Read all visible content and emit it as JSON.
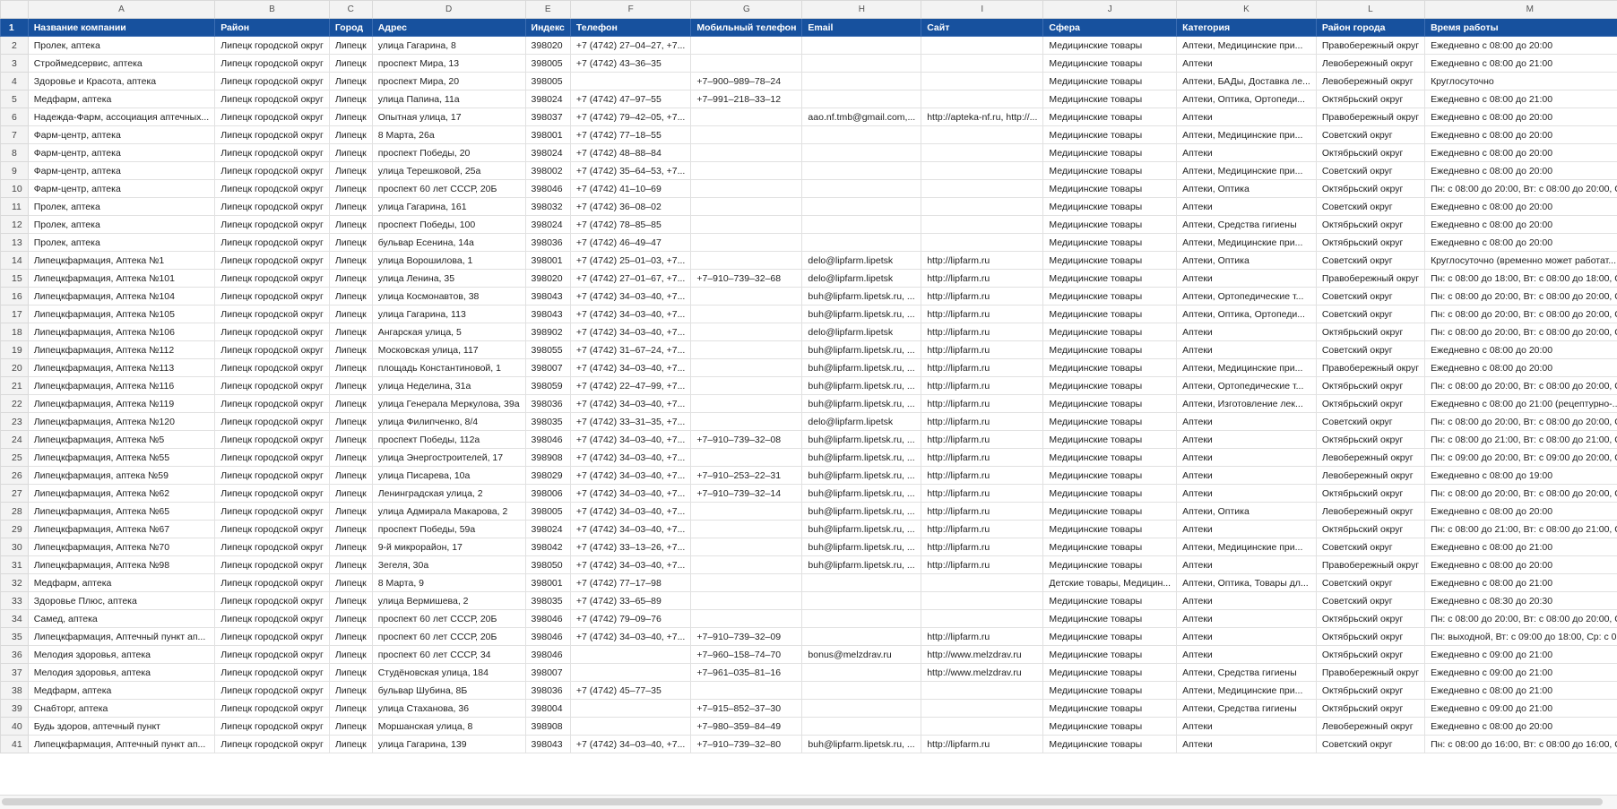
{
  "columns": [
    "A",
    "B",
    "C",
    "D",
    "E",
    "F",
    "G",
    "H",
    "I",
    "J",
    "K",
    "L",
    "M"
  ],
  "header": {
    "num": "1",
    "cells": [
      "Название компании",
      "Район",
      "Город",
      "Адрес",
      "Индекс",
      "Телефон",
      "Мобильный телефон",
      "Email",
      "Сайт",
      "Сфера",
      "Категория",
      "Район города",
      "Время работы"
    ]
  },
  "rows": [
    {
      "num": "2",
      "cells": [
        "Пролек, аптека",
        "Липецк городской округ",
        "Липецк",
        "улица Гагарина, 8",
        "398020",
        "+7 (4742) 27‒04‒27, +7...",
        "",
        "",
        "",
        "Медицинские товары",
        "Аптеки, Медицинские при...",
        "Правобережный округ",
        "Ежедневно с 08:00 до 20:00"
      ]
    },
    {
      "num": "3",
      "cells": [
        "Строймедсервис, аптека",
        "Липецк городской округ",
        "Липецк",
        "проспект Мира, 13",
        "398005",
        "+7 (4742) 43‒36‒35",
        "",
        "",
        "",
        "Медицинские товары",
        "Аптеки",
        "Левобережный округ",
        "Ежедневно с 08:00 до 21:00"
      ]
    },
    {
      "num": "4",
      "cells": [
        "Здоровье и Красота, аптека",
        "Липецк городской округ",
        "Липецк",
        "проспект Мира, 20",
        "398005",
        "",
        "+7‒900‒989‒78‒24",
        "",
        "",
        "Медицинские товары",
        "Аптеки, БАДы, Доставка ле...",
        "Левобережный округ",
        "Круглосуточно"
      ]
    },
    {
      "num": "5",
      "cells": [
        "Медфарм, аптека",
        "Липецк городской округ",
        "Липецк",
        "улица Папина, 11а",
        "398024",
        "+7 (4742) 47‒97‒55",
        "+7‒991‒218‒33‒12",
        "",
        "",
        "Медицинские товары",
        "Аптеки, Оптика, Ортопеди...",
        "Октябрьский округ",
        "Ежедневно с 08:00 до 21:00"
      ]
    },
    {
      "num": "6",
      "cells": [
        "Надежда-Фарм, ассоциация аптечных...",
        "Липецк городской округ",
        "Липецк",
        "Опытная улица, 17",
        "398037",
        "+7 (4742) 79‒42‒05, +7...",
        "",
        "aao.nf.tmb@gmail.com,...",
        "http://apteka-nf.ru, http://...",
        "Медицинские товары",
        "Аптеки",
        "Правобережный округ",
        "Ежедневно с 08:00 до 20:00"
      ]
    },
    {
      "num": "7",
      "cells": [
        "Фарм-центр, аптека",
        "Липецк городской округ",
        "Липецк",
        "8 Марта, 26а",
        "398001",
        "+7 (4742) 77‒18‒55",
        "",
        "",
        "",
        "Медицинские товары",
        "Аптеки, Медицинские при...",
        "Советский округ",
        "Ежедневно с 08:00 до 20:00"
      ]
    },
    {
      "num": "8",
      "cells": [
        "Фарм-центр, аптека",
        "Липецк городской округ",
        "Липецк",
        "проспект Победы, 20",
        "398024",
        "+7 (4742) 48‒88‒84",
        "",
        "",
        "",
        "Медицинские товары",
        "Аптеки",
        "Октябрьский округ",
        "Ежедневно с 08:00 до 20:00"
      ]
    },
    {
      "num": "9",
      "cells": [
        "Фарм-центр, аптека",
        "Липецк городской округ",
        "Липецк",
        "улица Терешковой, 25а",
        "398002",
        "+7 (4742) 35‒64‒53, +7...",
        "",
        "",
        "",
        "Медицинские товары",
        "Аптеки, Медицинские при...",
        "Советский округ",
        "Ежедневно с 08:00 до 20:00"
      ]
    },
    {
      "num": "10",
      "cells": [
        "Фарм-центр, аптека",
        "Липецк городской округ",
        "Липецк",
        "проспект 60 лет СССР, 20Б",
        "398046",
        "+7 (4742) 41‒10‒69",
        "",
        "",
        "",
        "Медицинские товары",
        "Аптеки, Оптика",
        "Октябрьский округ",
        "Пн: с 08:00 до 20:00, Вт: с 08:00 до 20:00, С..."
      ]
    },
    {
      "num": "11",
      "cells": [
        "Пролек, аптека",
        "Липецк городской округ",
        "Липецк",
        "улица Гагарина, 161",
        "398032",
        "+7 (4742) 36‒08‒02",
        "",
        "",
        "",
        "Медицинские товары",
        "Аптеки",
        "Советский округ",
        "Ежедневно с 08:00 до 20:00"
      ]
    },
    {
      "num": "12",
      "cells": [
        "Пролек, аптека",
        "Липецк городской округ",
        "Липецк",
        "проспект Победы, 100",
        "398024",
        "+7 (4742) 78‒85‒85",
        "",
        "",
        "",
        "Медицинские товары",
        "Аптеки, Средства гигиены",
        "Октябрьский округ",
        "Ежедневно с 08:00 до 20:00"
      ]
    },
    {
      "num": "13",
      "cells": [
        "Пролек, аптека",
        "Липецк городской округ",
        "Липецк",
        "бульвар Есенина, 14а",
        "398036",
        "+7 (4742) 46‒49‒47",
        "",
        "",
        "",
        "Медицинские товары",
        "Аптеки, Медицинские при...",
        "Октябрьский округ",
        "Ежедневно с 08:00 до 20:00"
      ]
    },
    {
      "num": "14",
      "cells": [
        "Липецкфармация, Аптека №1",
        "Липецк городской округ",
        "Липецк",
        "улица Ворошилова, 1",
        "398001",
        "+7 (4742) 25‒01‒03, +7...",
        "",
        "delo@lipfarm.lipetsk",
        "http://lipfarm.ru",
        "Медицинские товары",
        "Аптеки, Оптика",
        "Советский округ",
        "Круглосуточно (временно может работат..."
      ]
    },
    {
      "num": "15",
      "cells": [
        "Липецкфармация, Аптека №101",
        "Липецк городской округ",
        "Липецк",
        "улица Ленина, 35",
        "398020",
        "+7 (4742) 27‒01‒67, +7...",
        "+7‒910‒739‒32‒68",
        "delo@lipfarm.lipetsk",
        "http://lipfarm.ru",
        "Медицинские товары",
        "Аптеки",
        "Правобережный округ",
        "Пн: с 08:00 до 18:00, Вт: с 08:00 до 18:00, С..."
      ]
    },
    {
      "num": "16",
      "cells": [
        "Липецкфармация, Аптека №104",
        "Липецк городской округ",
        "Липецк",
        "улица Космонавтов, 38",
        "398043",
        "+7 (4742) 34‒03‒40, +7...",
        "",
        "buh@lipfarm.lipetsk.ru, ...",
        "http://lipfarm.ru",
        "Медицинские товары",
        "Аптеки, Ортопедические т...",
        "Советский округ",
        "Пн: с 08:00 до 20:00, Вт: с 08:00 до 20:00, С..."
      ]
    },
    {
      "num": "17",
      "cells": [
        "Липецкфармация, Аптека №105",
        "Липецк городской округ",
        "Липецк",
        "улица Гагарина, 113",
        "398043",
        "+7 (4742) 34‒03‒40, +7...",
        "",
        "buh@lipfarm.lipetsk.ru, ...",
        "http://lipfarm.ru",
        "Медицинские товары",
        "Аптеки, Оптика, Ортопеди...",
        "Советский округ",
        "Пн: с 08:00 до 20:00, Вт: с 08:00 до 20:00, С..."
      ]
    },
    {
      "num": "18",
      "cells": [
        "Липецкфармация, Аптека №106",
        "Липецк городской округ",
        "Липецк",
        "Ангарская улица, 5",
        "398902",
        "+7 (4742) 34‒03‒40, +7...",
        "",
        "delo@lipfarm.lipetsk",
        "http://lipfarm.ru",
        "Медицинские товары",
        "Аптеки",
        "Октябрьский округ",
        "Пн: с 08:00 до 20:00, Вт: с 08:00 до 20:00, С..."
      ]
    },
    {
      "num": "19",
      "cells": [
        "Липецкфармация, Аптека №112",
        "Липецк городской округ",
        "Липецк",
        "Московская улица, 117",
        "398055",
        "+7 (4742) 31‒67‒24, +7...",
        "",
        "buh@lipfarm.lipetsk.ru, ...",
        "http://lipfarm.ru",
        "Медицинские товары",
        "Аптеки",
        "Советский округ",
        "Ежедневно с 08:00 до 20:00"
      ]
    },
    {
      "num": "20",
      "cells": [
        "Липецкфармация, Аптека №113",
        "Липецк городской округ",
        "Липецк",
        "площадь Константиновой, 1",
        "398007",
        "+7 (4742) 34‒03‒40, +7...",
        "",
        "buh@lipfarm.lipetsk.ru, ...",
        "http://lipfarm.ru",
        "Медицинские товары",
        "Аптеки, Медицинские при...",
        "Правобережный округ",
        "Ежедневно с 08:00 до 20:00"
      ]
    },
    {
      "num": "21",
      "cells": [
        "Липецкфармация, Аптека №116",
        "Липецк городской округ",
        "Липецк",
        "улица Неделина, 31а",
        "398059",
        "+7 (4742) 22‒47‒99, +7...",
        "",
        "buh@lipfarm.lipetsk.ru, ...",
        "http://lipfarm.ru",
        "Медицинские товары",
        "Аптеки, Ортопедические т...",
        "Октябрьский округ",
        "Пн: с 08:00 до 20:00, Вт: с 08:00 до 20:00, С..."
      ]
    },
    {
      "num": "22",
      "cells": [
        "Липецкфармация, Аптека №119",
        "Липецк городской округ",
        "Липецк",
        "улица Генерала Меркулова, 39а",
        "398036",
        "+7 (4742) 34‒03‒40, +7...",
        "",
        "buh@lipfarm.lipetsk.ru, ...",
        "http://lipfarm.ru",
        "Медицинские товары",
        "Аптеки, Изготовление лек...",
        "Октябрьский округ",
        "Ежедневно с 08:00 до 21:00 (рецептурно-..."
      ]
    },
    {
      "num": "23",
      "cells": [
        "Липецкфармация, Аптека №120",
        "Липецк городской округ",
        "Липецк",
        "улица Филипченко, 8/4",
        "398035",
        "+7 (4742) 33‒31‒35, +7...",
        "",
        "delo@lipfarm.lipetsk",
        "http://lipfarm.ru",
        "Медицинские товары",
        "Аптеки",
        "Советский округ",
        "Пн: с 08:00 до 20:00, Вт: с 08:00 до 20:00, С..."
      ]
    },
    {
      "num": "24",
      "cells": [
        "Липецкфармация, Аптека №5",
        "Липецк городской округ",
        "Липецк",
        "проспект Победы, 112а",
        "398046",
        "+7 (4742) 34‒03‒40, +7...",
        "+7‒910‒739‒32‒08",
        "buh@lipfarm.lipetsk.ru, ...",
        "http://lipfarm.ru",
        "Медицинские товары",
        "Аптеки",
        "Октябрьский округ",
        "Пн: с 08:00 до 21:00, Вт: с 08:00 до 21:00, С..."
      ]
    },
    {
      "num": "25",
      "cells": [
        "Липецкфармация, Аптека №55",
        "Липецк городской округ",
        "Липецк",
        "улица Энергостроителей, 17",
        "398908",
        "+7 (4742) 34‒03‒40, +7...",
        "",
        "buh@lipfarm.lipetsk.ru, ...",
        "http://lipfarm.ru",
        "Медицинские товары",
        "Аптеки",
        "Левобережный округ",
        "Пн: с 09:00 до 20:00, Вт: с 09:00 до 20:00, С..."
      ]
    },
    {
      "num": "26",
      "cells": [
        "Липецкфармация, аптека №59",
        "Липецк городской округ",
        "Липецк",
        "улица Писарева, 10а",
        "398029",
        "+7 (4742) 34‒03‒40, +7...",
        "+7‒910‒253‒22‒31",
        "buh@lipfarm.lipetsk.ru, ...",
        "http://lipfarm.ru",
        "Медицинские товары",
        "Аптеки",
        "Левобережный округ",
        "Ежедневно с 08:00 до 19:00"
      ]
    },
    {
      "num": "27",
      "cells": [
        "Липецкфармация, Аптека №62",
        "Липецк городской округ",
        "Липецк",
        "Ленинградская улица, 2",
        "398006",
        "+7 (4742) 34‒03‒40, +7...",
        "+7‒910‒739‒32‒14",
        "buh@lipfarm.lipetsk.ru, ...",
        "http://lipfarm.ru",
        "Медицинские товары",
        "Аптеки",
        "Октябрьский округ",
        "Пн: с 08:00 до 20:00, Вт: с 08:00 до 20:00, С..."
      ]
    },
    {
      "num": "28",
      "cells": [
        "Липецкфармация, Аптека №65",
        "Липецк городской округ",
        "Липецк",
        "улица Адмирала Макарова, 2",
        "398005",
        "+7 (4742) 34‒03‒40, +7...",
        "",
        "buh@lipfarm.lipetsk.ru, ...",
        "http://lipfarm.ru",
        "Медицинские товары",
        "Аптеки, Оптика",
        "Левобережный округ",
        "Ежедневно с 08:00 до 20:00"
      ]
    },
    {
      "num": "29",
      "cells": [
        "Липецкфармация, Аптека №67",
        "Липецк городской округ",
        "Липецк",
        "проспект Победы, 59а",
        "398024",
        "+7 (4742) 34‒03‒40, +7...",
        "",
        "buh@lipfarm.lipetsk.ru, ...",
        "http://lipfarm.ru",
        "Медицинские товары",
        "Аптеки",
        "Октябрьский округ",
        "Пн: с 08:00 до 21:00, Вт: с 08:00 до 21:00, С..."
      ]
    },
    {
      "num": "30",
      "cells": [
        "Липецкфармация, Аптека №70",
        "Липецк городской округ",
        "Липецк",
        "9-й микрорайон, 17",
        "398042",
        "+7 (4742) 33‒13‒26, +7...",
        "",
        "buh@lipfarm.lipetsk.ru, ...",
        "http://lipfarm.ru",
        "Медицинские товары",
        "Аптеки, Медицинские при...",
        "Советский округ",
        "Ежедневно с 08:00 до 21:00"
      ]
    },
    {
      "num": "31",
      "cells": [
        "Липецкфармация, Аптека №98",
        "Липецк городской округ",
        "Липецк",
        "Зегеля, 30а",
        "398050",
        "+7 (4742) 34‒03‒40, +7...",
        "",
        "buh@lipfarm.lipetsk.ru, ...",
        "http://lipfarm.ru",
        "Медицинские товары",
        "Аптеки",
        "Правобережный округ",
        "Ежедневно с 08:00 до 20:00"
      ]
    },
    {
      "num": "32",
      "cells": [
        "Медфарм, аптека",
        "Липецк городской округ",
        "Липецк",
        "8 Марта, 9",
        "398001",
        "+7 (4742) 77‒17‒98",
        "",
        "",
        "",
        "Детские товары, Медицин...",
        "Аптеки, Оптика, Товары дл...",
        "Советский округ",
        "Ежедневно с 08:00 до 21:00"
      ]
    },
    {
      "num": "33",
      "cells": [
        "Здоровье Плюс, аптека",
        "Липецк городской округ",
        "Липецк",
        "улица Вермишева, 2",
        "398035",
        "+7 (4742) 33‒65‒89",
        "",
        "",
        "",
        "Медицинские товары",
        "Аптеки",
        "Советский округ",
        "Ежедневно с 08:30 до 20:30"
      ]
    },
    {
      "num": "34",
      "cells": [
        "Самед, аптека",
        "Липецк городской округ",
        "Липецк",
        "проспект 60 лет СССР, 20Б",
        "398046",
        "+7 (4742) 79‒09‒76",
        "",
        "",
        "",
        "Медицинские товары",
        "Аптеки",
        "Октябрьский округ",
        "Пн: с 08:00 до 20:00, Вт: с 08:00 до 20:00, С..."
      ]
    },
    {
      "num": "35",
      "cells": [
        "Липецкфармация, Аптечный пункт ап...",
        "Липецк городской округ",
        "Липецк",
        "проспект 60 лет СССР, 20Б",
        "398046",
        "+7 (4742) 34‒03‒40, +7...",
        "+7‒910‒739‒32‒09",
        "",
        "http://lipfarm.ru",
        "Медицинские товары",
        "Аптеки",
        "Октябрьский округ",
        "Пн: выходной, Вт: с 09:00 до 18:00, Ср: с 0..."
      ]
    },
    {
      "num": "36",
      "cells": [
        "Мелодия здоровья, аптека",
        "Липецк городской округ",
        "Липецк",
        "проспект 60 лет СССР, 34",
        "398046",
        "",
        "+7‒960‒158‒74‒70",
        "bonus@melzdrav.ru",
        "http://www.melzdrav.ru",
        "Медицинские товары",
        "Аптеки",
        "Октябрьский округ",
        "Ежедневно с 09:00 до 21:00"
      ]
    },
    {
      "num": "37",
      "cells": [
        "Мелодия здоровья, аптека",
        "Липецк городской округ",
        "Липецк",
        "Студёновская улица, 184",
        "398007",
        "",
        "+7‒961‒035‒81‒16",
        "",
        "http://www.melzdrav.ru",
        "Медицинские товары",
        "Аптеки, Средства гигиены",
        "Правобережный округ",
        "Ежедневно с 09:00 до 21:00"
      ]
    },
    {
      "num": "38",
      "cells": [
        "Медфарм, аптека",
        "Липецк городской округ",
        "Липецк",
        "бульвар Шубина, 8Б",
        "398036",
        "+7 (4742) 45‒77‒35",
        "",
        "",
        "",
        "Медицинские товары",
        "Аптеки, Медицинские при...",
        "Октябрьский округ",
        "Ежедневно с 08:00 до 21:00"
      ]
    },
    {
      "num": "39",
      "cells": [
        "Снабторг, аптека",
        "Липецк городской округ",
        "Липецк",
        "улица Стаханова, 36",
        "398004",
        "",
        "+7‒915‒852‒37‒30",
        "",
        "",
        "Медицинские товары",
        "Аптеки, Средства гигиены",
        "Октябрьский округ",
        "Ежедневно с 09:00 до 21:00"
      ]
    },
    {
      "num": "40",
      "cells": [
        "Будь здоров, аптечный пункт",
        "Липецк городской округ",
        "Липецк",
        "Моршанская улица, 8",
        "398908",
        "",
        "+7‒980‒359‒84‒49",
        "",
        "",
        "Медицинские товары",
        "Аптеки",
        "Левобережный округ",
        "Ежедневно с 08:00 до 20:00"
      ]
    },
    {
      "num": "41",
      "cells": [
        "Липецкфармация, Аптечный пункт ап...",
        "Липецк городской округ",
        "Липецк",
        "улица Гагарина, 139",
        "398043",
        "+7 (4742) 34‒03‒40, +7...",
        "+7‒910‒739‒32‒80",
        "buh@lipfarm.lipetsk.ru, ...",
        "http://lipfarm.ru",
        "Медицинские товары",
        "Аптеки",
        "Советский округ",
        "Пн: с 08:00 до 16:00, Вт: с 08:00 до 16:00, С..."
      ]
    }
  ],
  "colors": {
    "header_bg": "#17519e",
    "header_text": "#ffffff",
    "gridline": "#e1e1e1",
    "row_header_bg": "#f3f3f3"
  }
}
